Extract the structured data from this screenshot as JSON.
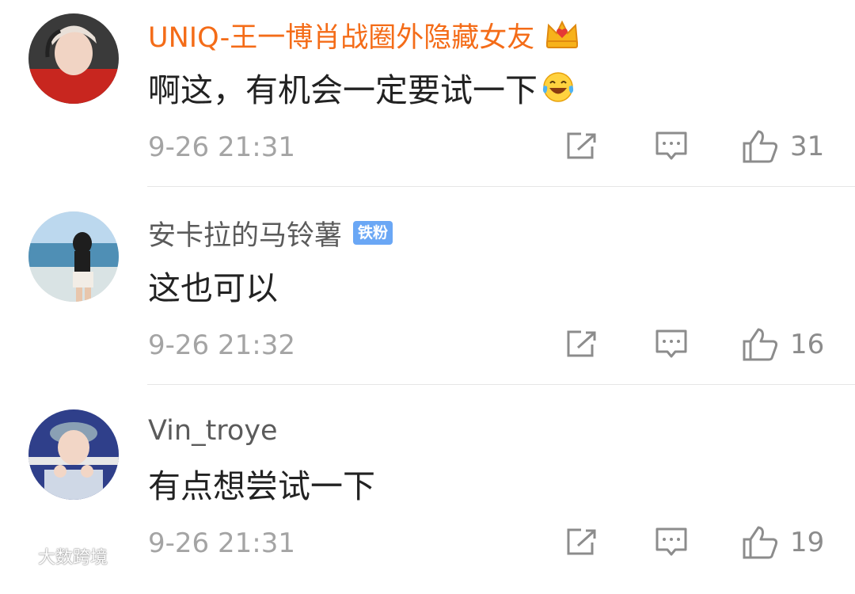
{
  "comments": [
    {
      "username": "UNIQ-王一博肖战圈外隐藏女友",
      "text": "啊这，有机会一定要试一下",
      "time": "9-26 21:31",
      "likes": "31",
      "badge": null,
      "has_crown": true,
      "username_color": "#f46c18"
    },
    {
      "username": "安卡拉的马铃薯",
      "text": "这也可以",
      "time": "9-26 21:32",
      "likes": "16",
      "badge": "铁粉",
      "has_crown": false
    },
    {
      "username": "Vin_troye",
      "text": "有点想尝试一下",
      "time": "9-26 21:31",
      "likes": "19",
      "badge": null,
      "has_crown": false
    }
  ],
  "watermark": "大数跨境",
  "icons": {
    "share": "share-icon",
    "reply": "comment-icon",
    "like": "thumbs-up-icon",
    "crown": "crown-icon",
    "emoji": "laughing-tears-emoji-icon"
  }
}
